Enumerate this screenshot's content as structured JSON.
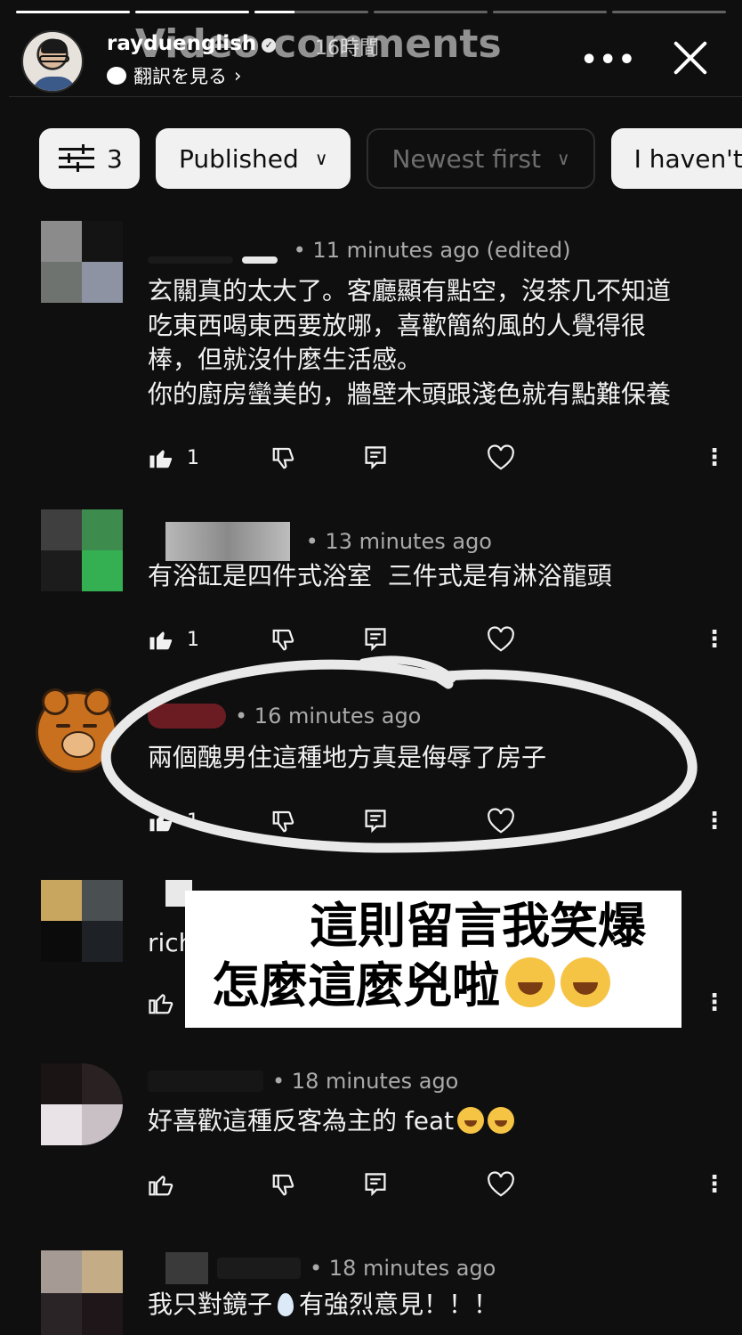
{
  "story": {
    "progress": [
      1,
      1,
      0.35,
      0,
      0,
      0
    ],
    "username": "rayduenglish",
    "time": "16時間",
    "translate_label": "翻訳を見る",
    "overlay_title": "Video comments",
    "more_label": "•••"
  },
  "filters": {
    "filter_count": "3",
    "status": "Published",
    "sort": "Newest first",
    "response": "I haven't"
  },
  "comments": [
    {
      "time": "11 minutes ago (edited)",
      "text": "玄關真的太大了。客廳顯有點空，沒茶几不知道\n吃東西喝東西要放哪，喜歡簡約風的人覺得很\n棒，但就沒什麼生活感。\n你的廚房蠻美的，牆壁木頭跟淺色就有點難保養",
      "likes": "1"
    },
    {
      "time": "13 minutes ago",
      "text": "有浴缸是四件式浴室  三件式是有淋浴龍頭",
      "likes": "1"
    },
    {
      "time": "16 minutes ago",
      "text": "兩個醜男住這種地方真是侮辱了房子",
      "likes": "1"
    },
    {
      "time": "",
      "text": "rich",
      "likes": ""
    },
    {
      "time": "18 minutes ago",
      "text": "好喜歡這種反客為主的 feat",
      "likes": ""
    },
    {
      "time": "18 minutes ago",
      "text_a": "我只對鏡子",
      "text_b": "有強烈意見！！！",
      "likes": ""
    }
  ],
  "caption": {
    "line1": "這則留言我笑爆",
    "line2": "怎麼這麼兇啦"
  },
  "colors": {
    "background": "#0f0f0f",
    "chip_light": "#f1f1f1",
    "meta_gray": "#aaaaaa"
  }
}
